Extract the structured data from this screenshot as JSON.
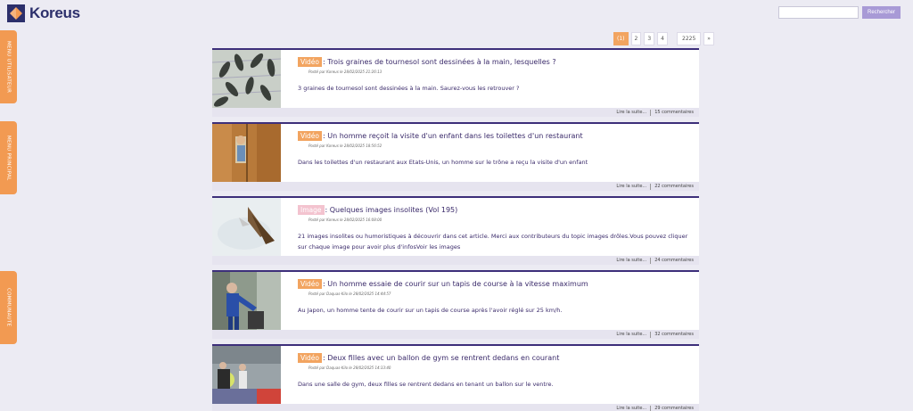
{
  "brand": {
    "name": "Koreus"
  },
  "search": {
    "placeholder": "",
    "button_label": "Rechercher"
  },
  "side_tabs": [
    "MENU UTILISATEUR",
    "MENU PRINCIPAL",
    "COMMUNAUTE"
  ],
  "pagination": {
    "pages": [
      "1",
      "2",
      "3",
      "4"
    ],
    "current": "1",
    "last": "2225",
    "next": "»"
  },
  "articles": [
    {
      "category": "Vidéo",
      "title": " : Trois graines de tournesol sont dessinées à la main, lesquelles ?",
      "meta": "Posté par Koreus le 28/02/2025 21:26:13",
      "desc": "3 graines de tournesol sont dessinées à la main. Saurez-vous les retrouver ?",
      "read_more": "Lire la suite...",
      "comments": "15 commentaires"
    },
    {
      "category": "Vidéo",
      "title": " : Un homme reçoit la visite d'un enfant dans les toilettes d'un restaurant",
      "meta": "Posté par Koreus le 28/02/2025 18:56:52",
      "desc": "Dans les toilettes d'un restaurant aux Etats-Unis, un homme sur le trône a reçu la visite d'un enfant",
      "read_more": "Lire la suite...",
      "comments": "22 commentaires"
    },
    {
      "category": "Image",
      "title": " : Quelques images insolites (Vol 195)",
      "meta": "Posté par Koreus le 28/02/2025 16:08:00",
      "desc": "21 images insolites ou humoristiques à découvrir dans cet article. Merci aux contributeurs du topic images drôles.Vous pouvez cliquer sur chaque image pour avoir plus d'infosVoir les images",
      "read_more": "Lire la suite...",
      "comments": "24 commentaires"
    },
    {
      "category": "Vidéo",
      "title": " : Un homme essaie de courir sur un tapis de course à la vitesse maximum",
      "meta": "Posté par Daquas-Kilo le 28/02/2025 14:44:57",
      "desc": "Au Japon, un homme tente de courir sur un tapis de course après l'avoir réglé sur 25 km/h.",
      "read_more": "Lire la suite...",
      "comments": "32 commentaires"
    },
    {
      "category": "Vidéo",
      "title": " : Deux filles avec un ballon de gym se rentrent dedans en courant",
      "meta": "Posté par Daquas-Kilo le 28/02/2025 14:33:40",
      "desc": "Dans une salle de gym, deux filles se rentrent dedans en tenant un ballon sur le ventre.",
      "read_more": "Lire la suite...",
      "comments": "29 commentaires"
    }
  ]
}
